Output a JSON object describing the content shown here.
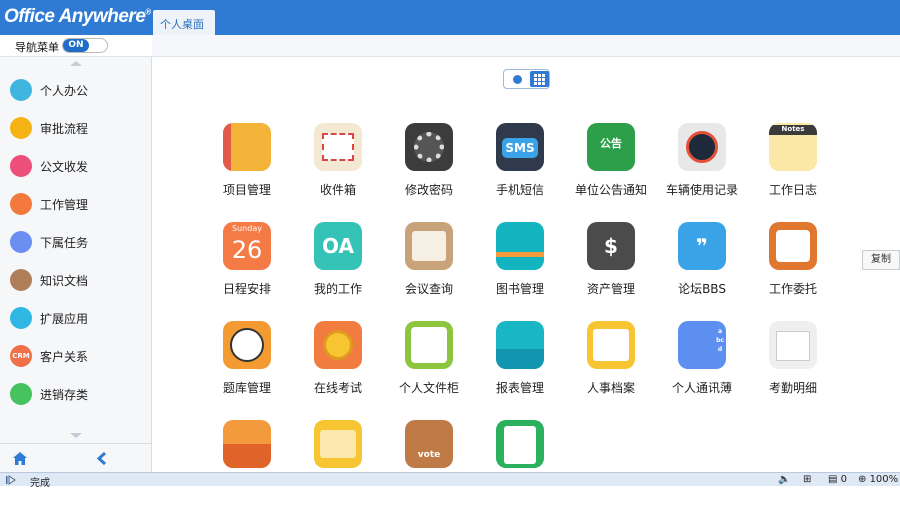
{
  "window": {
    "logo": "Office Anywhere",
    "logo_mark": "®"
  },
  "tabs": [
    {
      "label": "个人桌面",
      "close": "×"
    }
  ],
  "nav_toggle": {
    "label": "导航菜单",
    "state": "ON"
  },
  "sidebar": {
    "items": [
      {
        "label": "个人办公",
        "icon": "person-icon",
        "color": "#3fb6e0",
        "glyph": ""
      },
      {
        "label": "审批流程",
        "icon": "approval-icon",
        "color": "#f5b315",
        "glyph": ""
      },
      {
        "label": "公文收发",
        "icon": "document-icon",
        "color": "#ee4f7a",
        "glyph": ""
      },
      {
        "label": "工作管理",
        "icon": "task-icon",
        "color": "#f37a3c",
        "glyph": ""
      },
      {
        "label": "下属任务",
        "icon": "team-icon",
        "color": "#6a8ef2",
        "glyph": ""
      },
      {
        "label": "知识文档",
        "icon": "book-icon",
        "color": "#b07f5a",
        "glyph": ""
      },
      {
        "label": "扩展应用",
        "icon": "extension-icon",
        "color": "#2fb7e3",
        "glyph": ""
      },
      {
        "label": "客户关系",
        "icon": "crm-icon",
        "color": "#f0704a",
        "glyph": "CRM"
      },
      {
        "label": "进销存类",
        "icon": "inventory-icon",
        "color": "#46c25e",
        "glyph": ""
      }
    ]
  },
  "apps": [
    {
      "label": "项目管理",
      "icon": "notebook-icon",
      "color": "#f4b43a"
    },
    {
      "label": "收件箱",
      "icon": "envelope-icon",
      "color": "#f3e9d3"
    },
    {
      "label": "修改密码",
      "icon": "gear-icon",
      "color": "#3c3c3c"
    },
    {
      "label": "手机短信",
      "icon": "sms-icon",
      "color": "#2f3a4c",
      "text": "SMS"
    },
    {
      "label": "单位公告通知",
      "icon": "blackboard-icon",
      "color": "#2d9e4a",
      "text": "公告"
    },
    {
      "label": "车辆使用记录",
      "icon": "speedometer-icon",
      "color": "#e8e8e8"
    },
    {
      "label": "工作日志",
      "icon": "notes-icon",
      "color": "#fbe7a6",
      "text": "Notes"
    },
    {
      "label": "日程安排",
      "icon": "calendar-icon",
      "color": "#f47a46",
      "text": "Sunday",
      "day": "26"
    },
    {
      "label": "我的工作",
      "icon": "oa-icon",
      "color": "#35c3b8",
      "text": "OA"
    },
    {
      "label": "会议查询",
      "icon": "meeting-icon",
      "color": "#c8a278"
    },
    {
      "label": "图书管理",
      "icon": "book-icon",
      "color": "#12b5bf"
    },
    {
      "label": "资产管理",
      "icon": "safe-icon",
      "color": "#4b4b4b",
      "text": "$"
    },
    {
      "label": "论坛BBS",
      "icon": "chat-icon",
      "color": "#3aa3e8",
      "text": "❞"
    },
    {
      "label": "工作委托",
      "icon": "delegate-icon",
      "color": "#e0772e"
    },
    {
      "label": "题库管理",
      "icon": "clock-icon",
      "color": "#f39a33"
    },
    {
      "label": "在线考试",
      "icon": "medal-icon",
      "color": "#f27b3f"
    },
    {
      "label": "个人文件柜",
      "icon": "cabinet-icon",
      "color": "#8cc63e"
    },
    {
      "label": "报表管理",
      "icon": "report-icon",
      "color": "#19b7c6"
    },
    {
      "label": "人事档案",
      "icon": "profile-icon",
      "color": "#f7c531"
    },
    {
      "label": "个人通讯薄",
      "icon": "contacts-icon",
      "color": "#5d8ff1",
      "text": "abcd"
    },
    {
      "label": "考勤明细",
      "icon": "attendance-icon",
      "color": "#efefef"
    },
    {
      "label": "",
      "icon": "origami-icon",
      "color": "#f29a3c"
    },
    {
      "label": "",
      "icon": "folder-icon",
      "color": "#f7c531"
    },
    {
      "label": "",
      "icon": "vote-icon",
      "color": "#c07a46",
      "text": "vote"
    },
    {
      "label": "",
      "icon": "clipboard-icon",
      "color": "#2bb05e"
    }
  ],
  "copy_button": "复制",
  "status": {
    "text": "完成",
    "right_count": "0",
    "zoom": "100%"
  }
}
